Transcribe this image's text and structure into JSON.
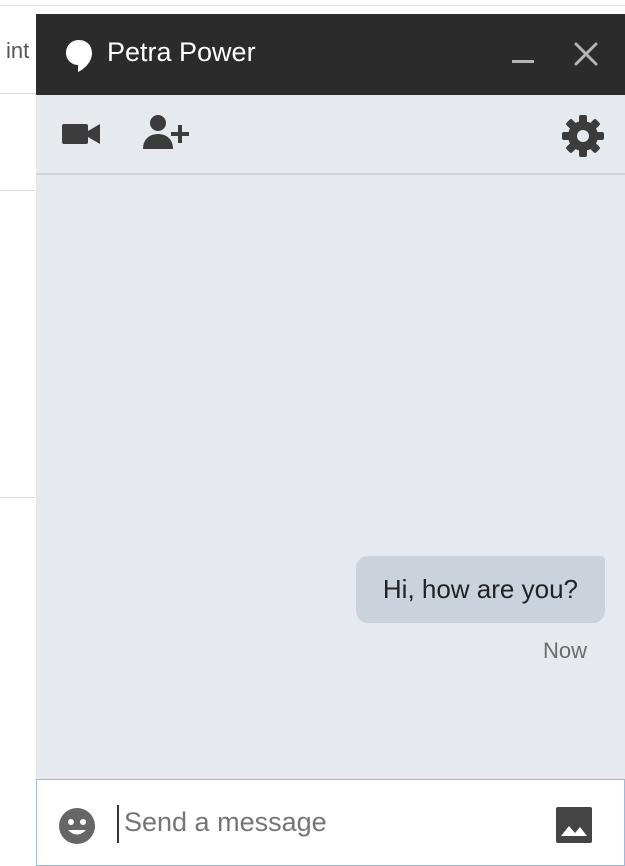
{
  "background": {
    "partial_text": "int"
  },
  "chat": {
    "contact_name": "Petra Power",
    "icons": {
      "hangouts": "hangouts-icon",
      "minimize": "minimize-icon",
      "close": "close-icon",
      "video": "video-camera-icon",
      "add_person": "add-person-icon",
      "settings": "gear-icon",
      "emoji": "smiley-icon",
      "image": "image-icon"
    },
    "messages": [
      {
        "text": "Hi, how are you?",
        "time": "Now",
        "sender": "self"
      }
    ],
    "composer": {
      "placeholder": "Send a message",
      "value": ""
    },
    "colors": {
      "titlebar": "#2b2b2b",
      "panel": "#e6eaee",
      "bubble": "#cad3db",
      "icon": "#3c3c3c"
    }
  }
}
